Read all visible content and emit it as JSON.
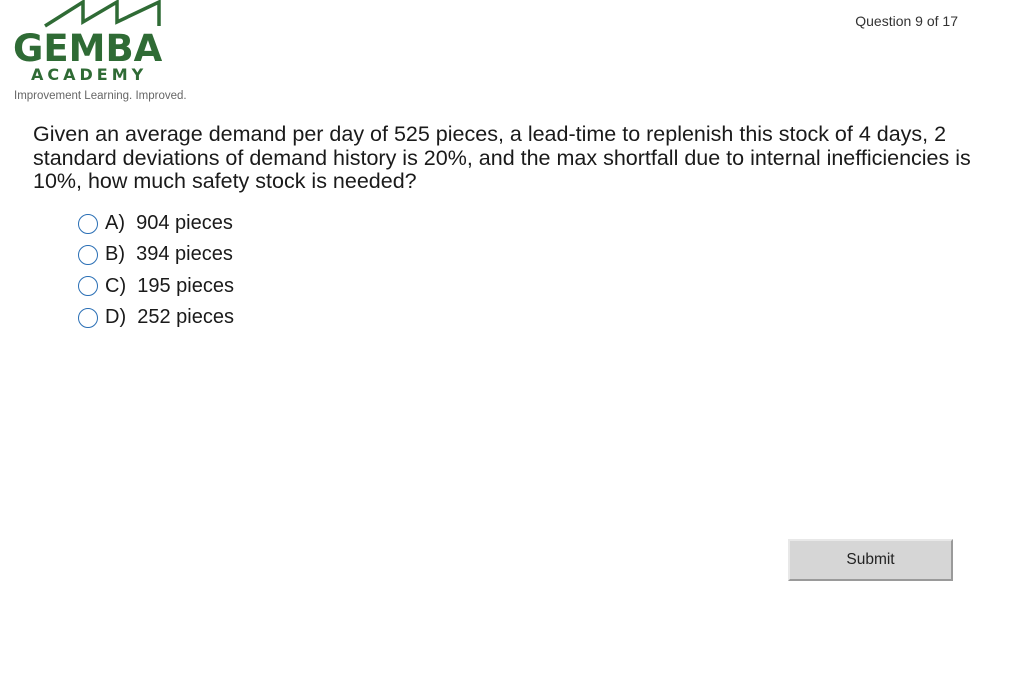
{
  "logo": {
    "name": "GEMBA",
    "subname": "ACADEMY",
    "tagline": "Improvement Learning. Improved.",
    "color": "#2f6b35"
  },
  "header": {
    "progress": "Question 9 of 17"
  },
  "question": {
    "text": "Given an average demand per day of 525 pieces, a lead-time to replenish this stock of 4 days, 2 standard deviations of demand history is 20%, and the max shortfall due to internal inefficiencies is 10%, how much safety stock is needed?"
  },
  "options": [
    {
      "label": "A)  904 pieces",
      "selected": false
    },
    {
      "label": "B)  394 pieces",
      "selected": false
    },
    {
      "label": "C)  195 pieces",
      "selected": false
    },
    {
      "label": "D)  252 pieces",
      "selected": false
    }
  ],
  "actions": {
    "submit_label": "Submit"
  },
  "colors": {
    "radio_border": "#2a6fb5",
    "button_bg": "#d6d6d6"
  }
}
